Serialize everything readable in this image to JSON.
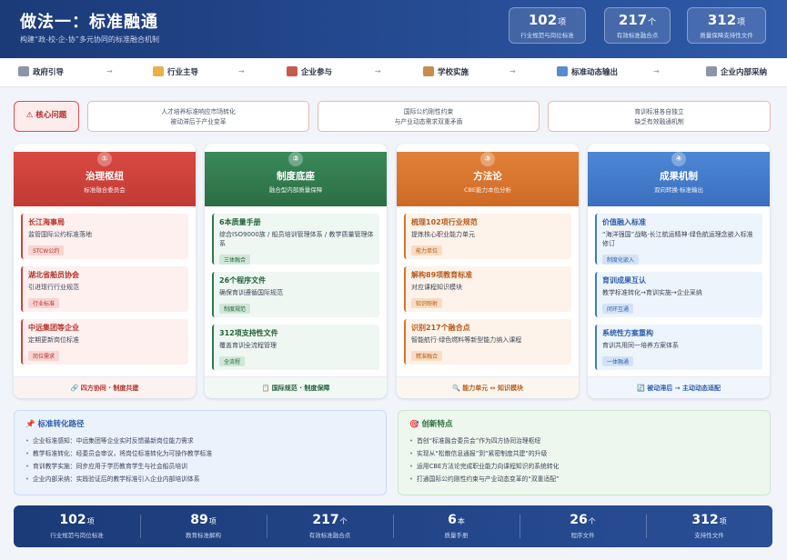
{
  "header": {
    "title": "做法一：标准融通",
    "subtitle": "构建“政-校-企-协”多元协同的标准融合机制",
    "stats": [
      {
        "value": "102",
        "unit": "项",
        "label": "行业规范与岗位标准"
      },
      {
        "value": "217",
        "unit": "个",
        "label": "有效标准融合点"
      },
      {
        "value": "312",
        "unit": "项",
        "label": "质量保障支持性文件"
      }
    ]
  },
  "flow": {
    "items": [
      {
        "icon": "bank-icon",
        "label": "政府引导"
      },
      {
        "icon": "handshake-icon",
        "label": "行业主导"
      },
      {
        "icon": "factory-icon",
        "label": "企业参与"
      },
      {
        "icon": "school-icon",
        "label": "学校实施"
      },
      {
        "icon": "refresh-icon",
        "label": "标准动态输出"
      },
      {
        "icon": "building-icon",
        "label": "企业内部采纳"
      }
    ],
    "arrow": "→"
  },
  "core": {
    "label": "⚠ 核心问题",
    "issues": [
      [
        "人才培养标准响应市场转化",
        "被动滞后于产业变革"
      ],
      [
        "国际公约刚性约束",
        "与产业动态需求双重矛盾"
      ],
      [
        "育训标准各自独立",
        "缺乏有效融通机制"
      ]
    ]
  },
  "columns": [
    {
      "num": "①",
      "title": "治理枢纽",
      "sub": "标准融合委员会",
      "cards": [
        {
          "title": "长江海事局",
          "desc": "监管国际公约标准落地",
          "tag": "STCW公约"
        },
        {
          "title": "湖北省船员协会",
          "desc": "引进现行行业规范",
          "tag": "行业标准"
        },
        {
          "title": "中远集团等企业",
          "desc": "定期更新岗位标准",
          "tag": "岗位需求"
        }
      ],
      "footer": "🔗 四方协同 · 制度共建"
    },
    {
      "num": "②",
      "title": "制度底座",
      "sub": "融合型内部质量保障",
      "cards": [
        {
          "title": "6本质量手册",
          "desc": "综合ISO9000族 / 船员培训管理体系 / 教学质量管理体系",
          "tag": "三体融合"
        },
        {
          "title": "26个程序文件",
          "desc": "确保育训遵循国际规范",
          "tag": "制度规范"
        },
        {
          "title": "312项支持性文件",
          "desc": "覆盖育训全流程管理",
          "tag": "全流程"
        }
      ],
      "footer": "📋 国际规范 · 制度保障"
    },
    {
      "num": "③",
      "title": "方法论",
      "sub": "CBE能力本位分析",
      "cards": [
        {
          "title": "梳理102项行业规范",
          "desc": "提炼核心职业能力单元",
          "tag": "能力单位"
        },
        {
          "title": "解构89项教育标准",
          "desc": "对应课程知识模块",
          "tag": "知识映射"
        },
        {
          "title": "识别217个融合点",
          "desc": "智能航行·绿色燃料等新型能力纳入课程",
          "tag": "精准融合"
        }
      ],
      "footer": "🔍 能力单元 ↔ 知识模块"
    },
    {
      "num": "④",
      "title": "成果机制",
      "sub": "双向转换·标准输出",
      "cards": [
        {
          "title": "价值融入标准",
          "desc": "“海洋强国”战略·长江航运精神·绿色航运理念嵌入标准修订",
          "tag": "制度化嵌入"
        },
        {
          "title": "育训成果互认",
          "desc": "教学标准转化→育训实施→企业采纳",
          "tag": "闭环互通"
        },
        {
          "title": "系统性方案重构",
          "desc": "育训共用同一培养方案体系",
          "tag": "一体融通"
        }
      ],
      "footer": "🔄 被动滞后 → 主动动态适配"
    }
  ],
  "panels": {
    "path": {
      "title": "📌 标准转化路径",
      "items": [
        "企业标准感知：中远集团等企业实时反馈最新岗位能力需求",
        "教学标准转化：经委员会审议，将岗位标准转化为可操作教学标准",
        "育训教学实施：同步应用于学历教育学生与社会船员培训",
        "企业内部采纳：实践验证后的教学标准引入企业内部培训体系"
      ]
    },
    "innovation": {
      "title": "🎯 创新特点",
      "items": [
        "首创“标准融合委员会”作为四方协同治理枢纽",
        "实现从“松散信息通报”到“紧密制度共建”的升级",
        "运用CBE方法论完成职业能力向课程知识的系统转化",
        "打通国际公约刚性约束与产业动态变革的“双重适配”"
      ]
    }
  },
  "stats_bar": [
    {
      "value": "102",
      "unit": "项",
      "label": "行业规范与岗位标准"
    },
    {
      "value": "89",
      "unit": "项",
      "label": "教育标准解构"
    },
    {
      "value": "217",
      "unit": "个",
      "label": "有效标准融合点"
    },
    {
      "value": "6",
      "unit": "本",
      "label": "质量手册"
    },
    {
      "value": "26",
      "unit": "个",
      "label": "程序文件"
    },
    {
      "value": "312",
      "unit": "项",
      "label": "支持性文件"
    }
  ],
  "colors": {
    "governance": "#d2433c",
    "system": "#2f7a4c",
    "method": "#d9742a",
    "outcome": "#3f79c9",
    "navy": "#1b3a78"
  }
}
